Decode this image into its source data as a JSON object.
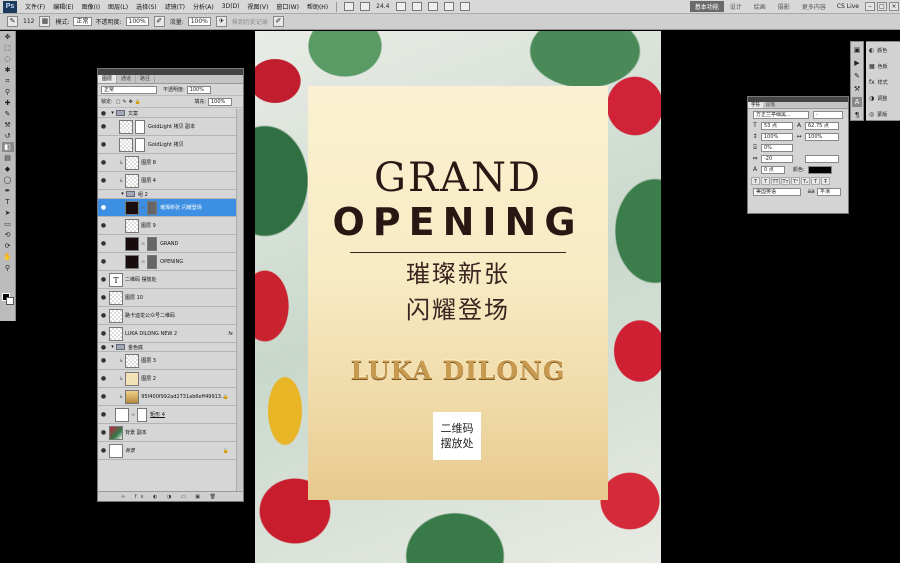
{
  "menubar": {
    "logo": "Ps",
    "items": [
      "文件(F)",
      "编辑(E)",
      "图像(I)",
      "图层(L)",
      "选择(S)",
      "滤镜(T)",
      "分析(A)",
      "3D(D)",
      "视图(V)",
      "窗口(W)",
      "帮助(H)"
    ],
    "zoom": "24.4",
    "workspaces": [
      "设计",
      "绘画",
      "摄影",
      "更多内容"
    ],
    "active_workspace": "基本功能",
    "cs_live": "CS Live"
  },
  "options": {
    "brush_size": "112",
    "mode_label": "模式:",
    "mode_value": "正常",
    "opacity_label": "不透明度:",
    "opacity_value": "100%",
    "flow_label": "流量:",
    "flow_value": "100%",
    "history_label": "抹到历史记录"
  },
  "layers": {
    "tabs": [
      "图层",
      "通道",
      "路径"
    ],
    "blend_mode": "正常",
    "opacity_label": "不透明度:",
    "opacity_value": "100%",
    "lock_label": "锁定:",
    "fill_label": "填充:",
    "fill_value": "100%",
    "items": [
      {
        "name": "文案",
        "type": "group"
      },
      {
        "name": "GoldLight 拷贝 副本",
        "type": "layer"
      },
      {
        "name": "GoldLight 拷贝",
        "type": "layer"
      },
      {
        "name": "图层 8",
        "type": "layer"
      },
      {
        "name": "图层 4",
        "type": "layer"
      },
      {
        "name": "组 2",
        "type": "group"
      },
      {
        "name": "璀璨新张 闪耀登场",
        "type": "layer",
        "selected": true
      },
      {
        "name": "图层 9",
        "type": "layer"
      },
      {
        "name": "GRAND",
        "type": "layer"
      },
      {
        "name": "OPENING",
        "type": "layer"
      },
      {
        "name": "二维码 摆放处",
        "type": "text"
      },
      {
        "name": "图层 10",
        "type": "layer"
      },
      {
        "name": "路卡迪龙公众号二维码",
        "type": "layer"
      },
      {
        "name": "LUKA DILONG NEW 2",
        "type": "layer",
        "fx": "fx"
      },
      {
        "name": "金色底",
        "type": "group"
      },
      {
        "name": "图层 3",
        "type": "layer"
      },
      {
        "name": "图层 2",
        "type": "layer"
      },
      {
        "name": "95f400f992ad2731ab6eff49913...",
        "type": "layer"
      },
      {
        "name": "矩形 4",
        "type": "layer"
      },
      {
        "name": "背景 副本",
        "type": "layer"
      },
      {
        "name": "背景",
        "type": "layer"
      }
    ],
    "footer_icons": "∞ fx ◐ ◑ ▭ ▣ 🗑"
  },
  "poster": {
    "title_line1": "GRAND",
    "title_line2": "OPENING",
    "cn_line1": "璀璨新张",
    "cn_line2": "闪耀登场",
    "brand": "LUKA DILONG",
    "qr_line1": "二维码",
    "qr_line2": "摆放处"
  },
  "character": {
    "tabs": [
      "字符",
      "段落"
    ],
    "font": "方正兰亭细黑...",
    "font_style": "-",
    "size": "53 点",
    "leading": "62.75 点",
    "vscale": "100%",
    "hscale": "100%",
    "tsume": "0%",
    "tracking": "-20",
    "baseline": "0 点",
    "color_label": "颜色:",
    "language": "美国英语",
    "aa": "平滑",
    "aa_prefix": "aa"
  },
  "dock": {
    "panels": [
      "颜色",
      "色板",
      "样式",
      "调整",
      "蒙版"
    ]
  }
}
